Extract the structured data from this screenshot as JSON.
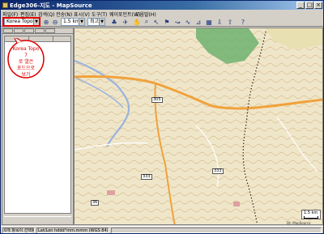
{
  "window": {
    "title": "Edge306-지도 - MapSource",
    "minimize": "_",
    "maximize": "□",
    "close": "×"
  },
  "menu": [
    "파일(F)",
    "편집(E)",
    "검색(Q)",
    "전송(N)",
    "표시(V)",
    "도구(T)",
    "웨이포인트(W)",
    "도움말(H)"
  ],
  "toolbar": {
    "map_product": "Korea Topo 7",
    "zoom_level": "1.5 km",
    "detail": "최고"
  },
  "annotation": {
    "line1": "Korea Topo 7",
    "line2": "로 열은",
    "line3": "포드으로",
    "line4": "보기"
  },
  "map": {
    "labels": [
      "305",
      "333",
      "333",
      "36"
    ],
    "scale_text": "1.5 km",
    "copyright": "Dt: MapSource"
  },
  "status": {
    "left": "0개 항목이 선택됨",
    "coords": "Lat/Lon hddd°mm.mmm (WGS 84)"
  },
  "colors": {
    "titlebar": "#0a246a",
    "highlight": "#e00000",
    "road_major": "#f0a23c",
    "water": "#9ab3dd",
    "forest": "#6fb06f"
  }
}
